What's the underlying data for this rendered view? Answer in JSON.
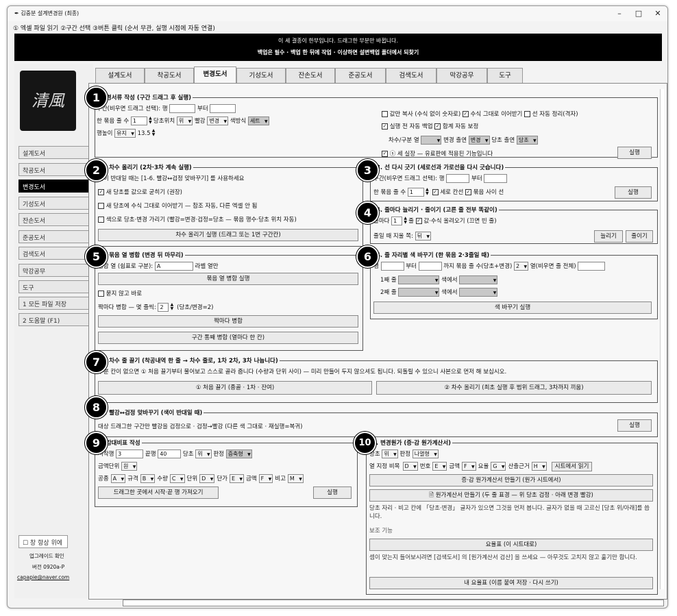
{
  "window": {
    "title": "김중분 설계변경원 (최종)",
    "min": "–",
    "max": "□",
    "close": "✕"
  },
  "steps": "① 엑셀 파일 읽기 ②구간 선택 ③버튼 클릭 (순서 무관, 실행 시점에 자동 연결)",
  "banner": {
    "line1": "이 세 결종이 한부입니다. 드래그한 부분만 바뀝니다.",
    "line2": "백업은 필수 · 백업 한 뒤에 작업 · 이상하면 설변백업 폴더에서 되찾기"
  },
  "logo": "清風",
  "sidebar": {
    "items": [
      "설계도서",
      "착공도서",
      "변경도서",
      "기성도서",
      "잔손도서",
      "준공도서",
      "검색도서",
      "막강공무",
      "도구"
    ],
    "active": 2,
    "save": "1 모든 파일 저장",
    "help": "2 도움말 (F1)",
    "always_top": "☐ 창 항상 위에",
    "upgrade": "업그레이드 확인",
    "version": "버전 0920a-P",
    "email": "capapie@naver.com"
  },
  "tabs": [
    "설계도서",
    "착공도서",
    "변경도서",
    "기성도서",
    "잔손도서",
    "준공도서",
    "검색도서",
    "막강공무",
    "도구"
  ],
  "active_tab": 2,
  "s1": {
    "badge": "1",
    "legend": "변경서류 작성  (구간 드래그 후 실행)",
    "range_label": "구간(비우면 드래그 선택): 행",
    "from": "부터",
    "bundle_label": "한 묶음 줄 수",
    "bundle_val": "1",
    "pos_label": "당초위치",
    "pos_val": "위",
    "red_label": "빨강",
    "red_val": "변경",
    "color_label": "색방식",
    "color_val": "세트",
    "height_label": "행높이",
    "height_mode": "유지",
    "height_val": "13.5",
    "opt1": "값만 복사 (수식 없이 숫자로)",
    "opt2": "수식 그대로 이어받기",
    "opt3": "선 자동 정리(격자)",
    "opt4": "실행 전 자동 백업",
    "opt5": "합계 자동 보정",
    "col_label": "차수/구분 열",
    "change_out": "변경 출연",
    "change_val": "변경",
    "orig_out": "당초 출연",
    "orig_val": "당초",
    "new_feature": "ⓢ 세 실장 — 유료판에 적용된 기능입니다",
    "run": "실행"
  },
  "s2": {
    "badge": "2",
    "legend": "2. 차수 올리기  (2차·3차 계속 실행)",
    "hint": "색이 반대일 때는 [1-6. 빨강↔검정 맞바꾸기] 를 사용하세요",
    "o1": "새 당초를 값으로 굳히기 (권장)",
    "o2": "새 당초에 수식 그대로 이어받기 — 참조 자동, 다른 엑셀 안 됨",
    "o3": "색으로 당초·변경 가리기 (빨강=변경·검정=당초 — 묶음 행수·당초 위치 자동)",
    "run": "차수 올리기 실행 (드래그 또는 1번 구간칸)"
  },
  "s3": {
    "badge": "3",
    "legend": "3. 선 다시 긋기  (세로선과 가로선을 다시 긋습니다)",
    "range_label": "구간(비우면 드래그 선택): 행",
    "from": "부터",
    "bundle_label": "한 묶음 줄 수",
    "bundle_val": "1",
    "v": "세로 칸선",
    "h": "묶음 사이 선",
    "run": "실행"
  },
  "s4": {
    "badge": "4",
    "legend": "4. 줄마다 늘리기 · 줄이기  (고른 줄 전부 똑같이)",
    "every": "줄마다",
    "every_val": "1",
    "unit": "줄",
    "formula": "값·수식 올려오기 (끄면 빈 줄)",
    "side_label": "줄일 때 지울 쪽:",
    "side_val": "뒤",
    "inc": "늘리기",
    "dec": "줄이기"
  },
  "s5": {
    "badge": "5",
    "legend": "5. 묶음 열 병합  (변경 뒤 마무리)",
    "col_label": "병합 열 (쉼표로 구분):",
    "col_val": "A",
    "label_col": "라벨 열만",
    "run": "묶음 열 병합 실행",
    "no_ask": "묻지 않고 바로",
    "pair_label": "짝마다 병합 — 몇 줄씩:",
    "pair_val": "2",
    "pair_hint": "(당초/변경=2)",
    "pair_btn": "짝마다 병합",
    "mid_btn": "구간 통째 병합 (열마다 한 칸)"
  },
  "s6": {
    "badge": "6",
    "legend": "4. 줄 자리별 색 바꾸기  (한 묶음 2·3줄일 때)",
    "row_label": "행",
    "from": "부터",
    "to": "까지 묶음 줄 수(당초+변경)",
    "count": "2",
    "col": "열(비우면 줄 전체)",
    "l1": "1째 줄",
    "l2": "2째 줄",
    "as": "색에서",
    "run": "색 바꾸기 실행"
  },
  "s7": {
    "badge": "7",
    "legend": "6. 차수 줄 끌기  (착공내역 한 줄 → 차수 줄로, 1차 2차, 3차 나눕니다)",
    "hint": "구분 칸이 없으면 ① 처음 끌기부터 물어보고 스스로 골라 줍니다 (수량과 단위 사이) — 미리 만들어 두지 않으셔도 됩니다. 되돌릴 수 있으니 사본으로 먼저 해 보십시오.",
    "b1": "① 처음 끌기 (종골 · 1차 · 잔여)",
    "b2": "② 차수 올리기 (최초 실행 후 범위 드래그, 3차까지 끼움)"
  },
  "s8": {
    "badge": "8",
    "legend": "5. 빨강↔검정 맞바꾸기  (색이 반대일 때)",
    "hint": "대상 드래그한 구간만  빨강을 검정으로 · 검정→빨강 (다른 색 그대로 · 재실행=복귀)",
    "run": "실행"
  },
  "s9": {
    "badge": "9",
    "legend": "증감대비표 작성",
    "start": "시작행",
    "start_val": "3",
    "end": "끝행",
    "end_val": "40",
    "pos": "당초",
    "pos_val": "위",
    "judge": "판정",
    "judge_val": "증축형",
    "unit": "금액단위",
    "unit_val": "원",
    "labels": [
      "공종",
      "A",
      "규격",
      "B",
      "수량",
      "C",
      "단위",
      "D",
      "단가",
      "E",
      "금액",
      "F",
      "비고",
      "M"
    ],
    "fetch": "드래그한 곳에서 시작·끝 행 가져오기",
    "run": "실행"
  },
  "s10": {
    "badge": "10",
    "legend": "2. 변경원가  (증·감 원가계산서)",
    "pos": "당초",
    "pos_val": "위",
    "judge": "판정",
    "judge_val": "나열형",
    "col_label": "열 지정 비목",
    "labels": [
      "D",
      "번호",
      "E",
      "금액",
      "F",
      "요율",
      "G",
      "산출근거",
      "H"
    ],
    "sheet_btn": "시트에서 읽기",
    "b1": "증·감 원가계산서 만들기 (원가 시트에서)",
    "b2": "🗎 원가계산서 만들기 (두 줄 표경 — 위 당초 검정 · 아래 변경 빨강)",
    "hint1": "당초 자리 · 비고 칸에 「당초·변경」 글자가 있으면 그것을 먼저 봅니다. 글자가 없을 때 고르신 [당초 위/아래]를 씁니다.",
    "aux": "보조 기능",
    "rate": "요율표 (이 시트대로)",
    "hint2": "셈이 맞는지 들어보시려면 [검색도서] 의 [원가계산서 검산] 을 쓰세요 — 아무것도 고치지 않고 훑기만 합니다.",
    "mine": "내 요율표 (이름 붙여 저장 · 다시 쓰기)"
  }
}
